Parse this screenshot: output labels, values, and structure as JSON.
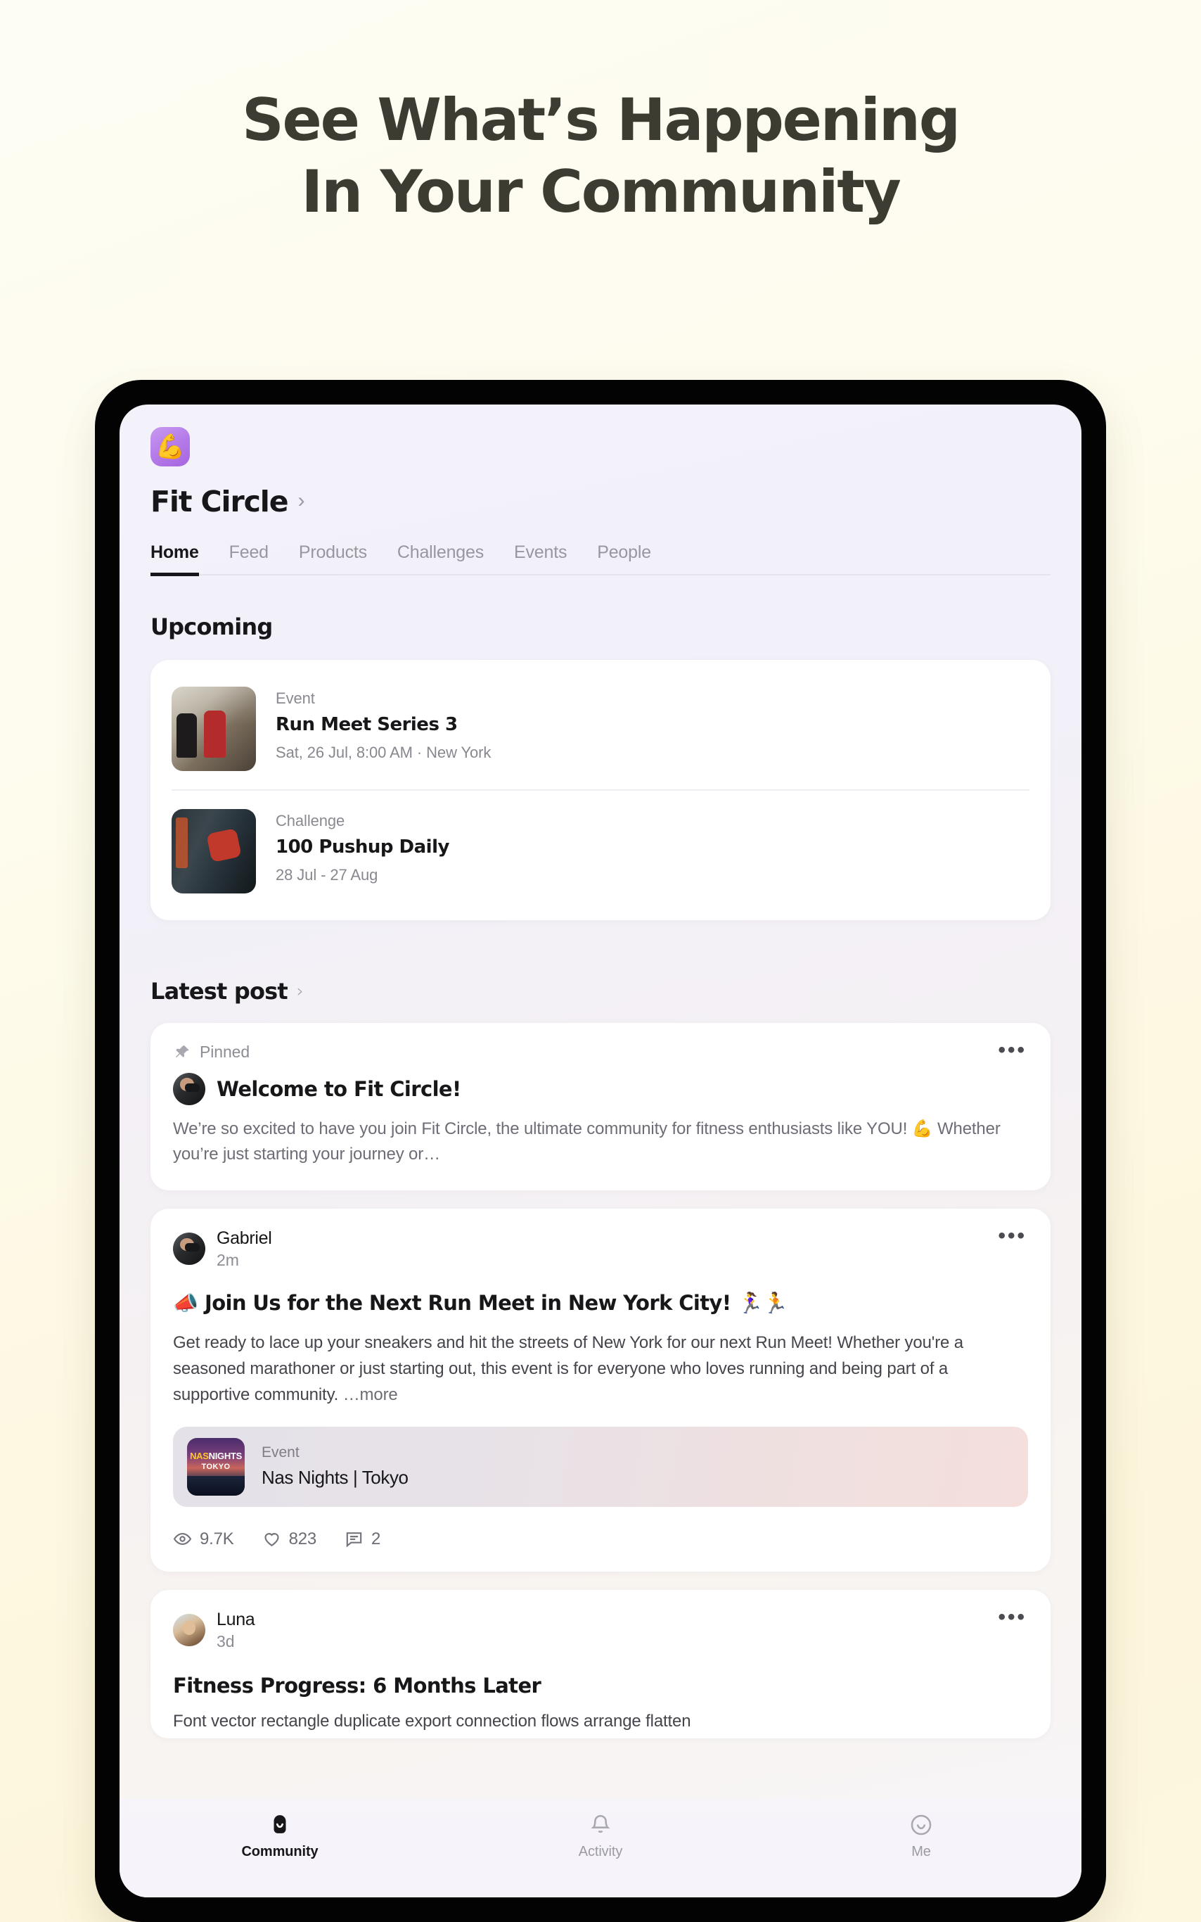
{
  "headline": {
    "line1": "See What’s Happening",
    "line2": "In Your Community"
  },
  "app": {
    "logo_icon": "dumbbell-arm-emoji",
    "community_name": "Fit Circle",
    "chevron": "›",
    "tabs": [
      {
        "label": "Home",
        "active": true
      },
      {
        "label": "Feed",
        "active": false
      },
      {
        "label": "Products",
        "active": false
      },
      {
        "label": "Challenges",
        "active": false
      },
      {
        "label": "Events",
        "active": false
      },
      {
        "label": "People",
        "active": false
      }
    ],
    "upcoming": {
      "section_title": "Upcoming",
      "items": [
        {
          "kicker": "Event",
          "title": "Run Meet Series 3",
          "sub": "Sat, 26 Jul, 8:00 AM · New York",
          "thumb": "runners-photo"
        },
        {
          "kicker": "Challenge",
          "title": "100 Pushup Daily",
          "sub": "28 Jul - 27 Aug",
          "thumb": "pushup-photo"
        }
      ]
    },
    "latest": {
      "section_title": "Latest post",
      "chevron": "›",
      "pinned_post": {
        "pinned_label": "Pinned",
        "pin_icon": "pin-icon",
        "title": "Welcome to Fit Circle!",
        "body": "We’re so excited to have you join Fit Circle, the ultimate community for fitness enthusiasts like YOU! 💪 Whether you’re just starting your journey or…",
        "menu": "•••"
      },
      "gabriel_post": {
        "author": "Gabriel",
        "time": "2m",
        "menu": "•••",
        "title": "📣 Join Us for the Next Run Meet in New York City! 🏃‍♀️🏃",
        "body": "Get ready to lace up your sneakers and hit the streets of New York for our next Run Meet! Whether you're a seasoned marathoner or just starting out, this event is for everyone who loves running and being part of a supportive community.",
        "more_label": "…more",
        "embed": {
          "kicker": "Event",
          "title": "Nas Nights | Tokyo",
          "thumb_nas": "NAS",
          "thumb_nights": "NIGHTS",
          "thumb_tokyo": "TOKYO"
        },
        "stats": [
          {
            "icon": "eye-icon",
            "value": "9.7K"
          },
          {
            "icon": "heart-icon",
            "value": "823"
          },
          {
            "icon": "comment-icon",
            "value": "2"
          }
        ]
      },
      "luna_post": {
        "author": "Luna",
        "time": "3d",
        "menu": "•••",
        "title": "Fitness Progress: 6 Months Later",
        "body": "Font vector rectangle duplicate export connection flows arrange flatten"
      }
    },
    "bottom_nav": [
      {
        "label": "Community",
        "icon": "community-icon",
        "active": true
      },
      {
        "label": "Activity",
        "icon": "bell-icon",
        "active": false
      },
      {
        "label": "Me",
        "icon": "smiley-icon",
        "active": false
      }
    ]
  },
  "colors": {
    "page_bg_top": "#FEFDF4",
    "page_bg_bottom": "#FDF6DC",
    "headline_text": "#3C3C33",
    "app_bg": "#F3F1F9",
    "card_bg": "#FFFFFF",
    "accent_dark": "#17171A",
    "muted_text": "#8D8C95",
    "logo_purple": "#B379E8"
  }
}
